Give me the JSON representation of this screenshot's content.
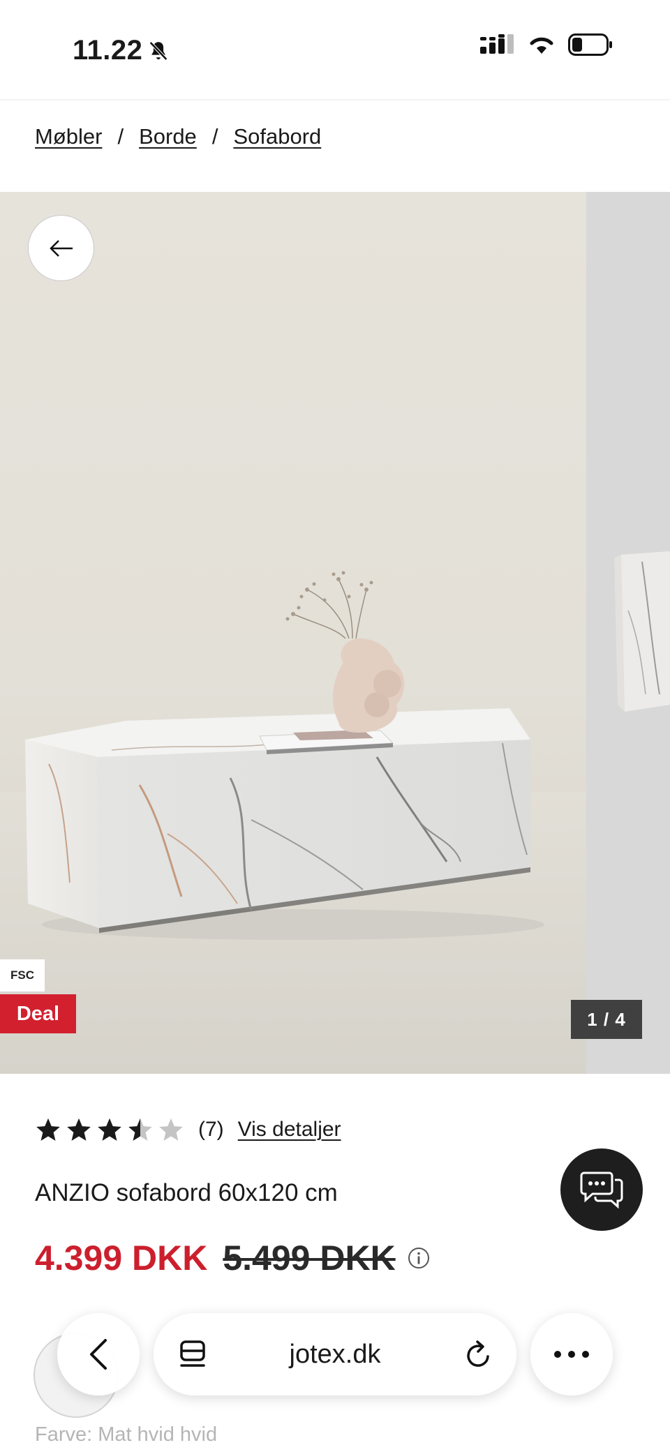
{
  "status_bar": {
    "time": "11.22",
    "icons": [
      "bell-slash-icon",
      "cellular-signal-icon",
      "wifi-icon",
      "battery-icon"
    ]
  },
  "breadcrumb": {
    "items": [
      "Møbler",
      "Borde",
      "Sofabord"
    ],
    "separator": "/"
  },
  "gallery": {
    "fsc_badge": "FSC",
    "deal_badge": "Deal",
    "counter": "1 / 4",
    "current_slide": 1,
    "total_slides": 4,
    "back_icon": "arrow-left-icon"
  },
  "product": {
    "rating_value": 3.5,
    "rating_max": 5,
    "rating_count": "(7)",
    "details_link": "Vis detaljer",
    "title": "ANZIO sofabord 60x120 cm",
    "price_current": "4.399 DKK",
    "price_old": "5.499 DKK",
    "color_label": "Farve: Mat hvid hvid"
  },
  "browser": {
    "url": "jotex.dk",
    "icons": [
      "chevron-left-icon",
      "tabs-icon",
      "reload-icon",
      "more-icon"
    ]
  },
  "colors": {
    "price_red": "#cc1f2d",
    "deal_red": "#d2202f",
    "chat_bg": "#1e1e1e",
    "counter_bg": "#404040"
  }
}
